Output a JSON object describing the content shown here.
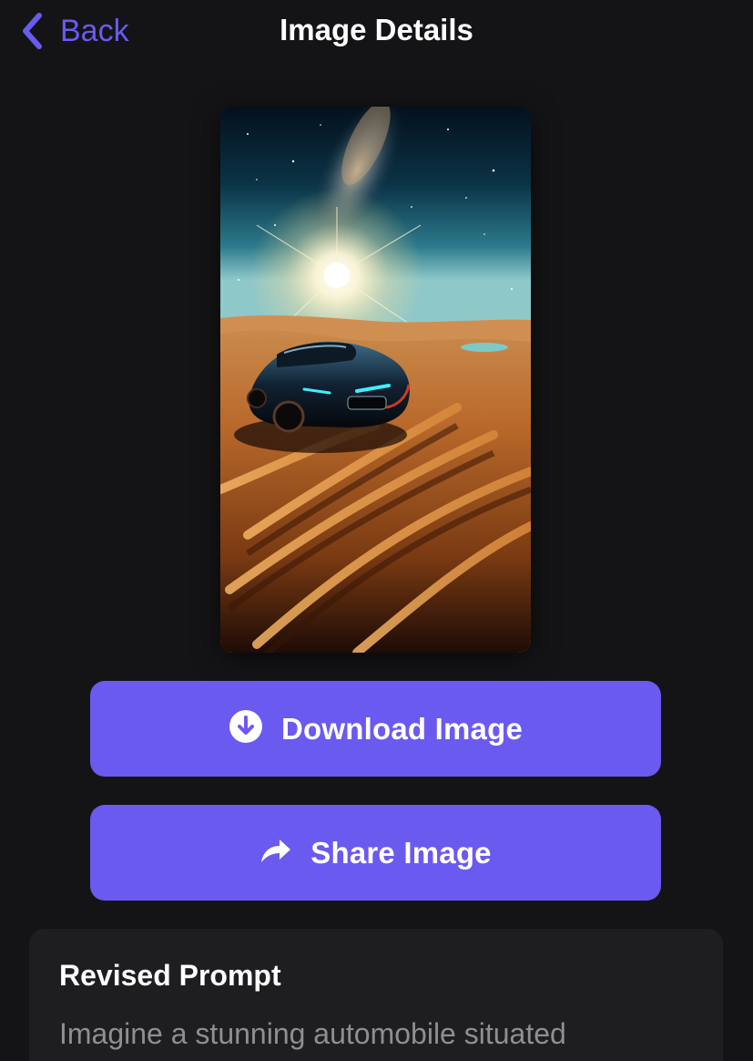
{
  "header": {
    "back_label": "Back",
    "title": "Image Details"
  },
  "artwork": {
    "subject": "sports car in desert dunes under starry sky"
  },
  "actions": {
    "download_label": "Download Image",
    "share_label": "Share Image"
  },
  "prompt": {
    "heading": "Revised Prompt",
    "text": "Imagine a stunning automobile situated"
  },
  "colors": {
    "accent": "#6a5af0",
    "background": "#141416",
    "card": "#1e1e21",
    "secondary_text": "#8e8e93"
  },
  "icons": {
    "back": "chevron-left-icon",
    "download": "arrow-down-circle-icon",
    "share": "share-arrow-icon"
  }
}
